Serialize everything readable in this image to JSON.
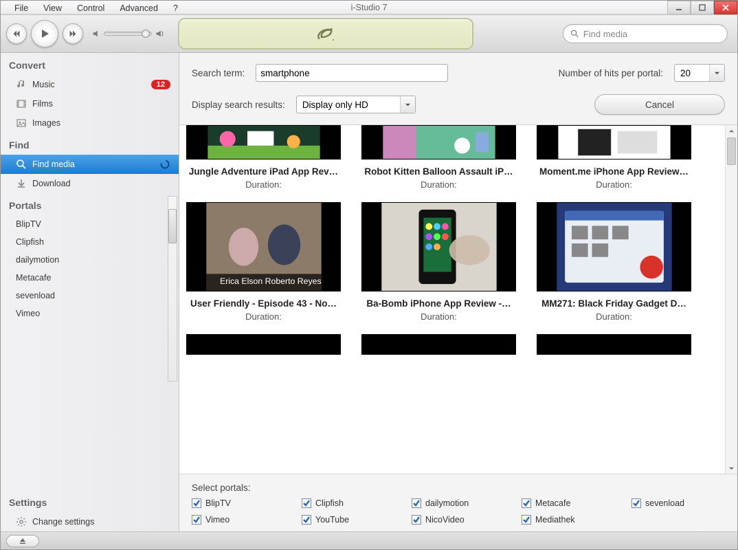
{
  "window_title": "i-Studio 7",
  "menu": [
    "File",
    "View",
    "Control",
    "Advanced",
    "?"
  ],
  "toolbar": {
    "find_placeholder": "Find media"
  },
  "sidebar": {
    "sections": {
      "convert": {
        "title": "Convert",
        "items": [
          {
            "label": "Music",
            "icon": "note-icon",
            "badge": "12"
          },
          {
            "label": "Films",
            "icon": "film-icon"
          },
          {
            "label": "Images",
            "icon": "image-icon"
          }
        ]
      },
      "find": {
        "title": "Find",
        "items": [
          {
            "label": "Find media",
            "icon": "search-icon",
            "selected": true,
            "spinner": true
          },
          {
            "label": "Download",
            "icon": "download-icon"
          }
        ]
      },
      "portals": {
        "title": "Portals",
        "items": [
          {
            "label": "BlipTV"
          },
          {
            "label": "Clipfish"
          },
          {
            "label": "dailymotion"
          },
          {
            "label": "Metacafe"
          },
          {
            "label": "sevenload"
          },
          {
            "label": "Vimeo"
          }
        ]
      },
      "settings": {
        "title": "Settings",
        "items": [
          {
            "label": "Change settings",
            "icon": "gear-icon"
          }
        ]
      }
    }
  },
  "search": {
    "term_label": "Search term:",
    "term_value": "smartphone",
    "hits_label": "Number of hits per portal:",
    "hits_value": "20",
    "display_label": "Display search results:",
    "display_value": "Display only HD",
    "cancel_label": "Cancel"
  },
  "results": [
    {
      "title": "Jungle Adventure iPad App Rev…",
      "duration_label": "Duration:"
    },
    {
      "title": "Robot Kitten Balloon Assault iP…",
      "duration_label": "Duration:"
    },
    {
      "title": "Moment.me iPhone App Review…",
      "duration_label": "Duration:"
    },
    {
      "title": "User Friendly - Episode 43 - No…",
      "duration_label": "Duration:"
    },
    {
      "title": "Ba-Bomb iPhone App Review -…",
      "duration_label": "Duration:"
    },
    {
      "title": "MM271: Black Friday Gadget D…",
      "duration_label": "Duration:"
    }
  ],
  "portals_panel": {
    "title": "Select portals:",
    "items": [
      "BlipTV",
      "Clipfish",
      "dailymotion",
      "Metacafe",
      "sevenload",
      "Vimeo",
      "YouTube",
      "NicoVideo",
      "Mediathek"
    ]
  }
}
